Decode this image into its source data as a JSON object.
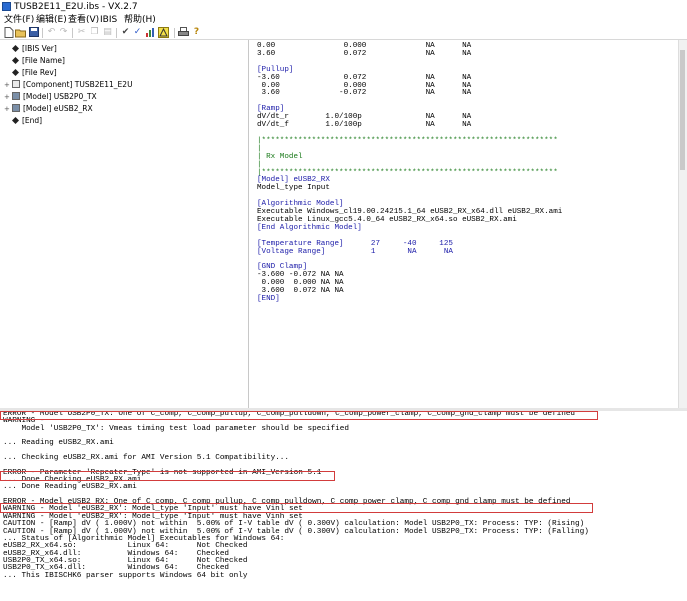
{
  "window": {
    "title": "TUSB2E11_E2U.ibs - VX.2.7"
  },
  "menu": [
    "文件(F)",
    "编辑(E)",
    "查看(V)",
    "IBIS",
    "帮助(H)"
  ],
  "toolbar_icons": [
    "new-file-icon",
    "open-folder-icon",
    "save-icon",
    "undo-icon",
    "redo-icon",
    "cut-icon",
    "copy-icon",
    "paste-icon",
    "check-icon",
    "checkmark-icon",
    "chart-icon",
    "warning-icon",
    "print-icon",
    "help-icon"
  ],
  "tree": [
    {
      "label": "[IBIS Ver]",
      "kind": "keyword",
      "expander": ""
    },
    {
      "label": "[File Name]",
      "kind": "keyword",
      "expander": ""
    },
    {
      "label": "[File Rev]",
      "kind": "keyword",
      "expander": ""
    },
    {
      "label": "[Component] TUSB2E11_E2U",
      "kind": "component",
      "expander": "+"
    },
    {
      "label": "[Model] USB2P0_TX",
      "kind": "model",
      "expander": "+"
    },
    {
      "label": "[Model] eUSB2_RX",
      "kind": "model",
      "expander": "+"
    },
    {
      "label": "[End]",
      "kind": "keyword",
      "expander": ""
    }
  ],
  "editor": {
    "lines": [
      {
        "t": "0.00               0.000             NA      NA",
        "c": ""
      },
      {
        "t": "3.60               0.072             NA      NA",
        "c": ""
      },
      {
        "t": "",
        "c": ""
      },
      {
        "t": "[Pullup]",
        "c": "kw"
      },
      {
        "t": "-3.60              0.072             NA      NA",
        "c": ""
      },
      {
        "t": " 0.00              0.000             NA      NA",
        "c": ""
      },
      {
        "t": " 3.60             -0.072             NA      NA",
        "c": ""
      },
      {
        "t": "",
        "c": ""
      },
      {
        "t": "[Ramp]",
        "c": "kw"
      },
      {
        "t": "dV/dt_r        1.0/100p              NA      NA",
        "c": ""
      },
      {
        "t": "dV/dt_f        1.0/100p              NA      NA",
        "c": ""
      },
      {
        "t": "",
        "c": ""
      },
      {
        "t": "|*****************************************************************",
        "c": "cm"
      },
      {
        "t": "|",
        "c": "cm"
      },
      {
        "t": "| Rx Model",
        "c": "cm"
      },
      {
        "t": "|",
        "c": "cm"
      },
      {
        "t": "|*****************************************************************",
        "c": "cm"
      },
      {
        "t": "[Model] eUSB2_RX",
        "c": "kw"
      },
      {
        "t": "Model_type Input",
        "c": ""
      },
      {
        "t": "",
        "c": ""
      },
      {
        "t": "[Algorithmic Model]",
        "c": "kw"
      },
      {
        "t": "Executable Windows_cl19.00.24215.1_64 eUSB2_RX_x64.dll eUSB2_RX.ami",
        "c": ""
      },
      {
        "t": "Executable Linux_gcc5.4.0_64 eUSB2_RX_x64.so eUSB2_RX.ami",
        "c": ""
      },
      {
        "t": "[End Algorithmic Model]",
        "c": "kw"
      },
      {
        "t": "",
        "c": ""
      },
      {
        "t": "[Temperature Range]      27     -40     125",
        "c": "kw"
      },
      {
        "t": "[Voltage Range]          1       NA      NA",
        "c": "kw"
      },
      {
        "t": "",
        "c": ""
      },
      {
        "t": "[GND Clamp]",
        "c": "kw"
      },
      {
        "t": "-3.600 -0.072 NA NA",
        "c": ""
      },
      {
        "t": " 0.000  0.000 NA NA",
        "c": ""
      },
      {
        "t": " 3.600  0.072 NA NA",
        "c": ""
      },
      {
        "t": "[END]",
        "c": "kw"
      }
    ]
  },
  "log": {
    "lines": [
      "ERROR - Model USB2P0_TX: One of C_comp, C_comp_pullup, C_comp_pulldown, C_comp_power_clamp, C_comp_gnd_clamp must be defined",
      "WARNING -",
      "    Model 'USB2P0_TX': Vmeas timing test load parameter should be specified",
      "",
      "... Reading eUSB2_RX.ami",
      "",
      "... Checking eUSB2_RX.ami for AMI Version 5.1 Compatibility...",
      "",
      "ERROR - Parameter 'Repeater_Type' is not supported in AMI_Version 5.1",
      "... Done Checking eUSB2_RX.ami",
      "... Done Reading eUSB2_RX.ami",
      "",
      "ERROR - Model eUSB2_RX: One of C_comp, C_comp_pullup, C_comp_pulldown, C_comp_power_clamp, C_comp_gnd_clamp must be defined",
      "WARNING - Model 'eUSB2_RX': Model_type 'Input' must have Vinl set",
      "WARNING - Model 'eUSB2_RX': Model_type 'Input' must have Vinh set",
      "CAUTION - [Ramp] dV ( 1.000V) not within  5.00% of I-V table dV ( 0.300V) calculation: Model USB2P0_TX: Process: TYP: (Rising)",
      "CAUTION - [Ramp] dV ( 1.000V) not within  5.00% of I-V table dV ( 0.300V) calculation: Model USB2P0_TX: Process: TYP: (Falling)",
      "... Status of [Algorithmic Model] Executables for Windows 64:",
      "eUSB2_RX_x64.so:           Linux 64:      Not Checked",
      "eUSB2_RX_x64.dll:          Windows 64:    Checked",
      "USB2P0_TX_x64.so:          Linux 64:      Not Checked",
      "USB2P0_TX_x64.dll:         Windows 64:    Checked",
      "... This IBISCHK6 parser supports Windows 64 bit only"
    ]
  }
}
